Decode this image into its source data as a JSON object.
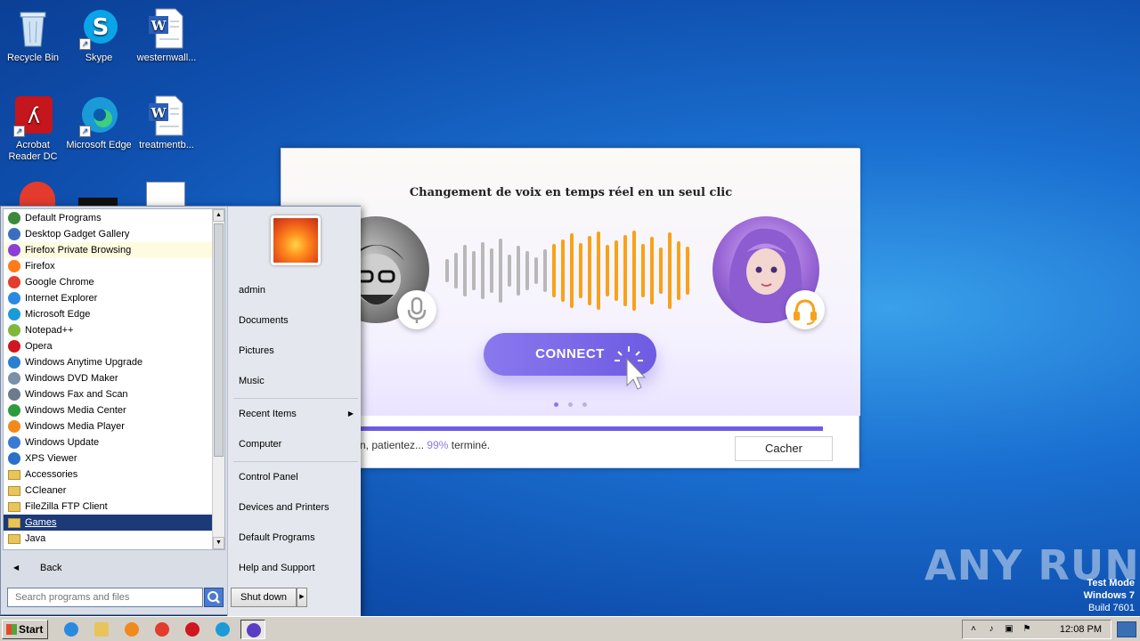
{
  "desktop": {
    "icons": [
      {
        "label": "Recycle Bin",
        "icon": "recycle-bin-icon"
      },
      {
        "label": "Skype",
        "icon": "skype-icon"
      },
      {
        "label": "westernwall...",
        "icon": "word-document-icon"
      },
      {
        "label": "Acrobat Reader DC",
        "icon": "acrobat-reader-icon"
      },
      {
        "label": "Microsoft Edge",
        "icon": "edge-icon"
      },
      {
        "label": "treatmentb...",
        "icon": "word-document-icon"
      }
    ]
  },
  "promo": {
    "title": "Changement de voix en temps réel en un seul clic",
    "connect_label": "CONNECT",
    "progress_text": "n, patientez...",
    "progress_value": "99%",
    "progress_suffix": "terminé.",
    "progress_fraction": 0.99,
    "hide_label": "Cacher",
    "bar_colors": {
      "left": "#b8b8b8",
      "right": "#f7a21b"
    }
  },
  "start_menu": {
    "programs": [
      {
        "label": "Default Programs",
        "color": "#3b8a3b"
      },
      {
        "label": "Desktop Gadget Gallery",
        "color": "#3a6fc0"
      },
      {
        "label": "Firefox Private Browsing",
        "color": "#8b3fd6"
      },
      {
        "label": "Firefox",
        "color": "#ff7a1a"
      },
      {
        "label": "Google Chrome",
        "color": "#e33b2e"
      },
      {
        "label": "Internet Explorer",
        "color": "#2a8ae0"
      },
      {
        "label": "Microsoft Edge",
        "color": "#1a9bd8"
      },
      {
        "label": "Notepad++",
        "color": "#7fb83b"
      },
      {
        "label": "Opera",
        "color": "#d0161e"
      },
      {
        "label": "Windows Anytime Upgrade",
        "color": "#2a7fd0"
      },
      {
        "label": "Windows DVD Maker",
        "color": "#7a8fa8"
      },
      {
        "label": "Windows Fax and Scan",
        "color": "#6b7b8b"
      },
      {
        "label": "Windows Media Center",
        "color": "#2e9a3e"
      },
      {
        "label": "Windows Media Player",
        "color": "#f08a1c"
      },
      {
        "label": "Windows Update",
        "color": "#3a7ad0"
      },
      {
        "label": "XPS Viewer",
        "color": "#2a6fc8"
      },
      {
        "label": "Accessories",
        "folder": true
      },
      {
        "label": "CCleaner",
        "folder": true
      },
      {
        "label": "FileZilla FTP Client",
        "folder": true
      },
      {
        "label": "Games",
        "folder": true
      },
      {
        "label": "Java",
        "folder": true
      }
    ],
    "back_label": "Back",
    "search_placeholder": "Search programs and files",
    "right_items": {
      "user": "admin",
      "documents": "Documents",
      "pictures": "Pictures",
      "music": "Music",
      "recent": "Recent Items",
      "computer": "Computer",
      "control_panel": "Control Panel",
      "devices": "Devices and Printers",
      "default_programs": "Default Programs",
      "help": "Help and Support"
    },
    "shutdown_label": "Shut down"
  },
  "taskbar": {
    "start_label": "Start",
    "pinned": [
      {
        "icon": "internet-explorer-icon",
        "color": "#2a8ae0"
      },
      {
        "icon": "explorer-folder-icon",
        "color": "#e8c55a"
      },
      {
        "icon": "media-player-icon",
        "color": "#f08a1c"
      },
      {
        "icon": "chrome-icon",
        "color": "#e33b2e"
      },
      {
        "icon": "opera-icon",
        "color": "#d0161e"
      },
      {
        "icon": "edge-icon",
        "color": "#1a9bd8"
      },
      {
        "icon": "voice-changer-app-icon",
        "color": "#5b3cc4"
      }
    ],
    "clock": "12:08 PM"
  },
  "watermark": "ANY RUN",
  "test_mode": {
    "line1": "Test Mode",
    "line2": "Windows 7",
    "line3": "Build 7601"
  }
}
